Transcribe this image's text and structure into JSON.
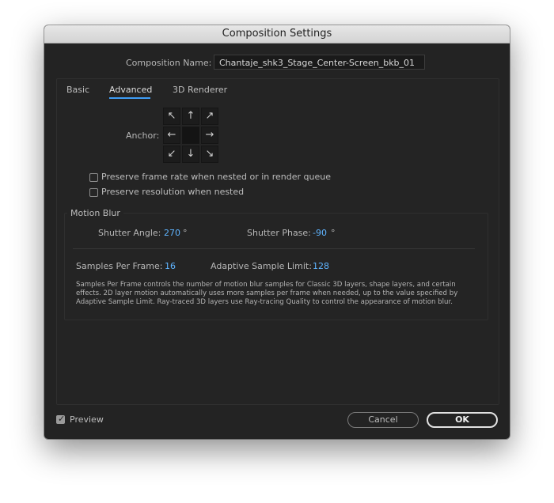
{
  "window": {
    "title": "Composition Settings"
  },
  "composition": {
    "name_label": "Composition Name:",
    "name_value": "Chantaje_shk3_Stage_Center-Screen_bkb_01"
  },
  "tabs": [
    {
      "label": "Basic",
      "active": false
    },
    {
      "label": "Advanced",
      "active": true
    },
    {
      "label": "3D Renderer",
      "active": false
    }
  ],
  "anchor": {
    "label": "Anchor:",
    "cells": [
      "↖",
      "↑",
      "↗",
      "←",
      "",
      "→",
      "↙",
      "↓",
      "↘"
    ]
  },
  "options": {
    "preserve_frame_rate": {
      "label": "Preserve frame rate when nested or in render queue",
      "checked": false
    },
    "preserve_resolution": {
      "label": "Preserve resolution when nested",
      "checked": false
    }
  },
  "motion_blur": {
    "title": "Motion Blur",
    "shutter_angle_label": "Shutter Angle:",
    "shutter_angle_value": "270",
    "shutter_angle_unit": "°",
    "shutter_phase_label": "Shutter Phase:",
    "shutter_phase_value": "-90",
    "shutter_phase_unit": "°",
    "samples_label": "Samples Per Frame:",
    "samples_value": "16",
    "adaptive_label": "Adaptive Sample Limit:",
    "adaptive_value": "128",
    "description": "Samples Per Frame controls the number of motion blur samples for Classic 3D layers, shape layers, and certain effects. 2D layer motion automatically uses more samples per frame when needed, up to the value specified by Adaptive Sample Limit. Ray-traced 3D layers use Ray-tracing Quality to control the appearance of motion blur."
  },
  "footer": {
    "preview_label": "Preview",
    "preview_checked": true,
    "cancel_label": "Cancel",
    "ok_label": "OK"
  },
  "colors": {
    "accent": "#3f9df5",
    "value": "#5fb4ff",
    "background": "#232323"
  }
}
